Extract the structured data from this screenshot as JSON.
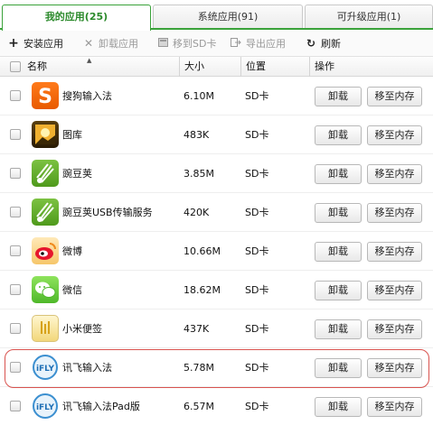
{
  "tabs": [
    {
      "label": "我的应用(25)",
      "active": true
    },
    {
      "label": "系统应用(91)",
      "active": false
    },
    {
      "label": "可升级应用(1)",
      "active": false
    }
  ],
  "toolbar": {
    "install": {
      "label": "安装应用",
      "icon": "plus-icon",
      "enabled": true
    },
    "uninstall": {
      "label": "卸载应用",
      "icon": "x-icon",
      "enabled": false
    },
    "move_sd": {
      "label": "移到SD卡",
      "icon": "sd-card-icon",
      "enabled": false
    },
    "export": {
      "label": "导出应用",
      "icon": "export-icon",
      "enabled": false
    },
    "refresh": {
      "label": "刷新",
      "icon": "refresh-icon",
      "enabled": true
    }
  },
  "columns": {
    "name": "名称",
    "size": "大小",
    "location": "位置",
    "actions": "操作"
  },
  "buttons": {
    "uninstall": "卸载",
    "move": "移至内存"
  },
  "apps": [
    {
      "name": "搜狗输入法",
      "size": "6.10M",
      "location": "SD卡",
      "icon": "sogou-icon"
    },
    {
      "name": "图库",
      "size": "483K",
      "location": "SD卡",
      "icon": "gallery-icon"
    },
    {
      "name": "豌豆荚",
      "size": "3.85M",
      "location": "SD卡",
      "icon": "wandoujia-icon"
    },
    {
      "name": "豌豆荚USB传输服务",
      "size": "420K",
      "location": "SD卡",
      "icon": "wandoujia-usb-icon"
    },
    {
      "name": "微博",
      "size": "10.66M",
      "location": "SD卡",
      "icon": "weibo-icon"
    },
    {
      "name": "微信",
      "size": "18.62M",
      "location": "SD卡",
      "icon": "wechat-icon"
    },
    {
      "name": "小米便签",
      "size": "437K",
      "location": "SD卡",
      "icon": "mi-notes-icon"
    },
    {
      "name": "讯飞输入法",
      "size": "5.78M",
      "location": "SD卡",
      "icon": "ifly-icon",
      "highlighted": true
    },
    {
      "name": "讯飞输入法Pad版",
      "size": "6.57M",
      "location": "SD卡",
      "icon": "ifly-pad-icon"
    }
  ],
  "colors": {
    "accent": "#3aa23a",
    "highlight": "#d9534f"
  }
}
